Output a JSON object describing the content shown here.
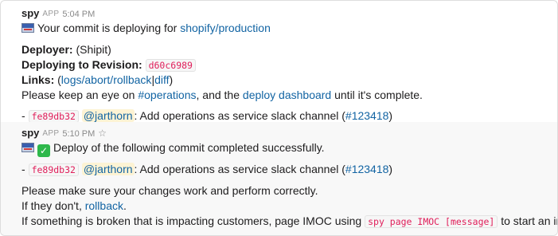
{
  "messages": [
    {
      "sender": "spy",
      "app_badge": "APP",
      "time": "5:04 PM",
      "headline": {
        "prefix": "Your commit is deploying for ",
        "link": "shopify/production"
      },
      "deployer": {
        "label": "Deployer:",
        "value": "(Shipit)"
      },
      "revision": {
        "label": "Deploying to Revision:",
        "code": "d60c6989"
      },
      "links": {
        "label": "Links:",
        "open": "(",
        "logs": "logs",
        "abort": "abort",
        "rollback": "rollback",
        "diff": "diff",
        "close": ")"
      },
      "watch": {
        "prefix": "Please keep an eye on ",
        "channel": "#operations",
        "middle": ", and the ",
        "dashboard": "deploy dashboard",
        "suffix": " until it's complete."
      },
      "commit": {
        "dash": "- ",
        "sha": "fe89db32",
        "user": "@jarthorn",
        "text": ": Add operations as service slack channel (",
        "pr": "#123418",
        "close": ")"
      }
    },
    {
      "sender": "spy",
      "app_badge": "APP",
      "time": "5:10 PM",
      "headline": "Deploy of the following commit completed successfully.",
      "commit": {
        "dash": "- ",
        "sha": "fe89db32",
        "user": "@jarthorn",
        "text": ": Add operations as service slack channel (",
        "pr": "#123418",
        "close": ")"
      },
      "verify": "Please make sure your changes work and perform correctly.",
      "rollback": {
        "prefix": "If they don't, ",
        "link": "rollback",
        "suffix": "."
      },
      "broken": {
        "prefix": "If something is broken that is impacting customers, page IMOC using ",
        "code": "spy page IMOC [message]",
        "suffix": " to start an incident."
      }
    }
  ],
  "icons": {
    "avatar_flag": "flag-icon",
    "success": "check-icon",
    "star": "star-icon"
  },
  "colors": {
    "link": "#1264a3",
    "code_text": "#e01e5a",
    "mention_bg": "#fdf3d4",
    "success_green": "#2eb84b"
  }
}
